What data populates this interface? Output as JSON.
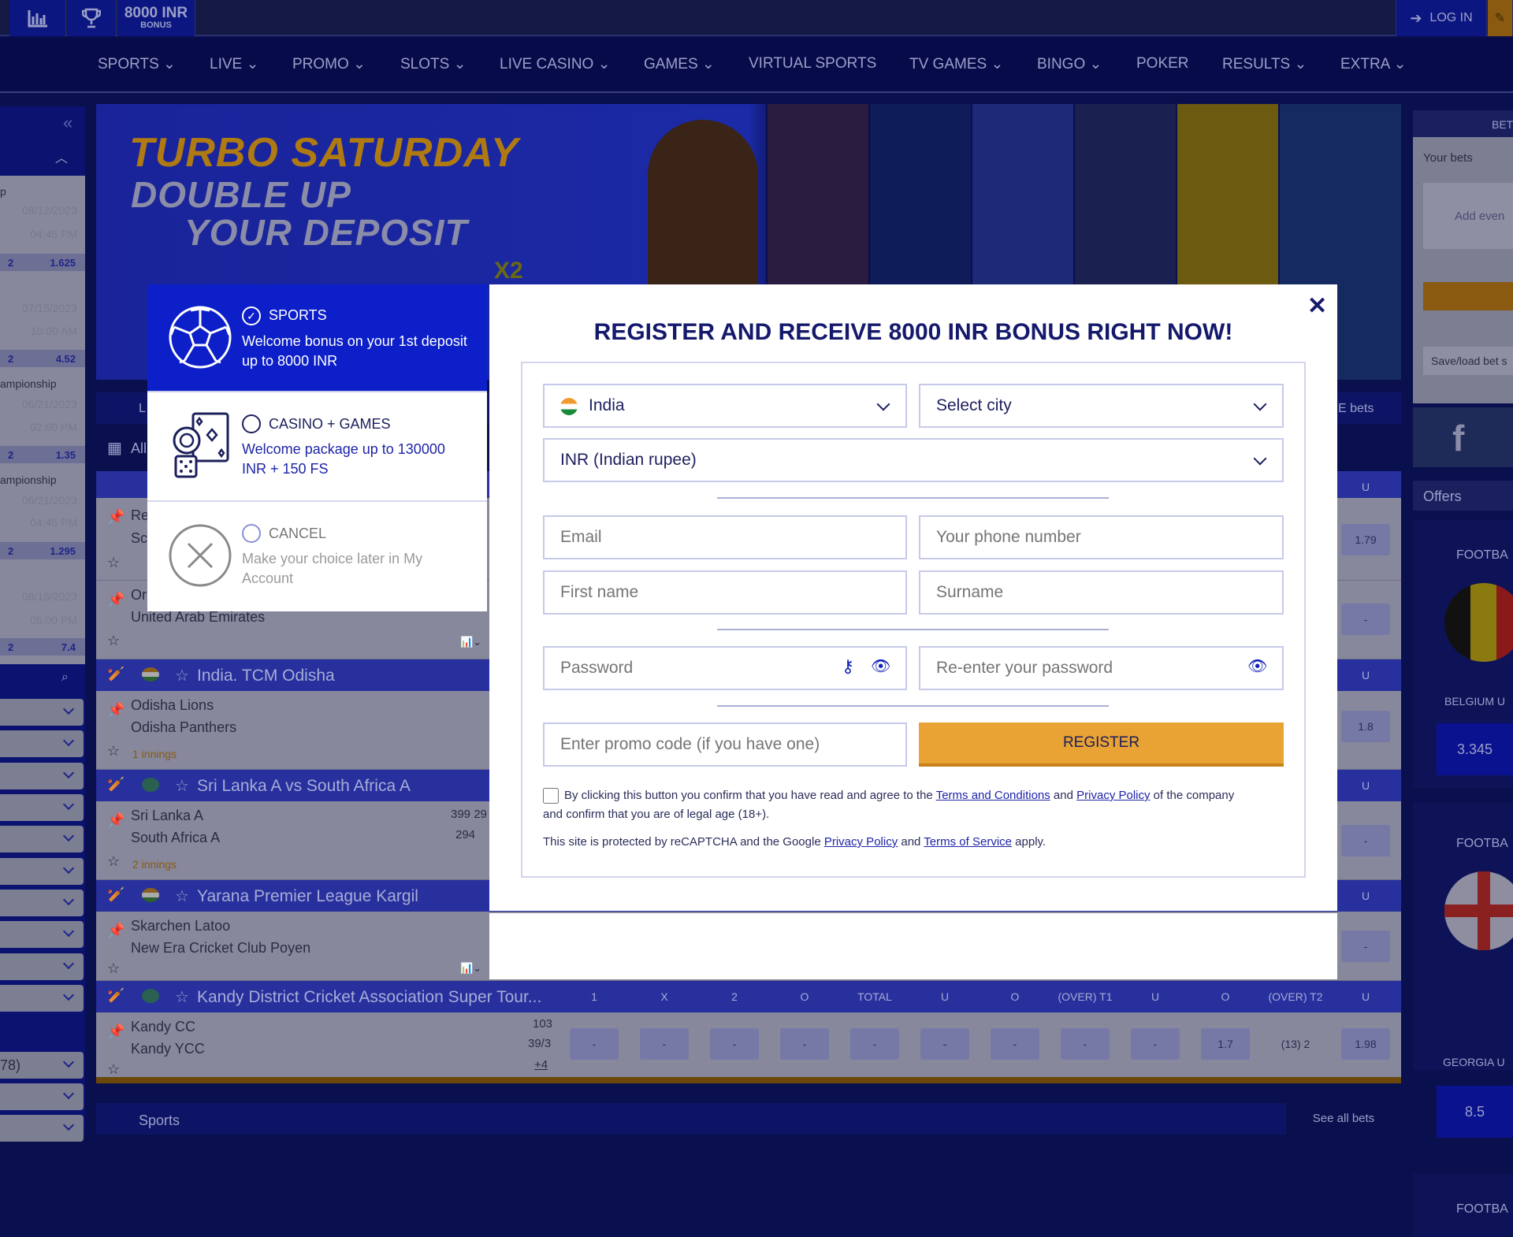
{
  "topbar": {
    "bonus_amount": "8000 INR",
    "bonus_label": "BONUS",
    "login_label": "LOG IN",
    "icons": [
      "stats-icon",
      "trophy-icon",
      "login-icon",
      "register-icon"
    ]
  },
  "nav": {
    "items": [
      {
        "label": "SPORTS",
        "dropdown": true
      },
      {
        "label": "LIVE",
        "dropdown": true
      },
      {
        "label": "PROMO",
        "dropdown": true
      },
      {
        "label": "SLOTS",
        "dropdown": true
      },
      {
        "label": "LIVE CASINO",
        "dropdown": true
      },
      {
        "label": "GAMES",
        "dropdown": true
      },
      {
        "label": "VIRTUAL SPORTS",
        "dropdown": false
      },
      {
        "label": "TV GAMES",
        "dropdown": true
      },
      {
        "label": "BINGO",
        "dropdown": true
      },
      {
        "label": "POKER",
        "dropdown": false
      },
      {
        "label": "RESULTS",
        "dropdown": true
      },
      {
        "label": "EXTRA",
        "dropdown": true
      }
    ]
  },
  "left_sidebar": {
    "events": [
      {
        "name": "p",
        "date": "08/12/2023",
        "time": "04:45 PM",
        "col": "2",
        "odds": "1.625"
      },
      {
        "name": "",
        "date": "07/15/2023",
        "time": "10:00 AM",
        "col": "2",
        "odds": "4.52"
      },
      {
        "name": "ampionship",
        "date": "06/21/2023",
        "time": "02:00 PM",
        "col": "2",
        "odds": "1.35"
      },
      {
        "name": "ampionship",
        "date": "06/21/2023",
        "time": "04:45 PM",
        "col": "2",
        "odds": "1.295"
      },
      {
        "name": "",
        "date": "08/16/2023",
        "time": "05:00 PM",
        "col": "2",
        "odds": "7.4"
      }
    ],
    "bottom_item": "78)"
  },
  "banner": {
    "line1": "TURBO SATURDAY",
    "line2": "DOUBLE UP",
    "line3": "YOUR DEPOSIT",
    "badge": "X2"
  },
  "events": {
    "live_tab": "L",
    "live_bets_tab": "E bets",
    "all_label": "All",
    "column_headers": [
      "1",
      "X",
      "2",
      "O",
      "TOTAL",
      "U",
      "O",
      "(OVER) T1",
      "U",
      "O",
      "(OVER) T2",
      "U"
    ],
    "groups": [
      {
        "title": "",
        "rows": [
          {
            "team1": "Re",
            "team2": "Sc",
            "last_odds": "1.79"
          },
          {
            "team1": "Or",
            "team2": "United Arab Emirates",
            "last_odds": "-"
          }
        ]
      },
      {
        "title": "India. TCM Odisha",
        "rows": [
          {
            "team1": "Odisha Lions",
            "team2": "Odisha Panthers",
            "note": "1 innings",
            "last_odds": "1.8"
          }
        ]
      },
      {
        "title": "Sri Lanka A vs South Africa A",
        "rows": [
          {
            "team1": "Sri Lanka A",
            "team2": "South Africa A",
            "note": "2 innings",
            "score1": "399 29",
            "score2": "294",
            "last_odds": "-"
          }
        ]
      },
      {
        "title": "Yarana Premier League Kargil",
        "rows": [
          {
            "team1": "Skarchen Latoo",
            "team2": "New Era Cricket Club Poyen",
            "last_odds": "-"
          }
        ]
      },
      {
        "title": "Kandy District Cricket Association Super Tour...",
        "rows": [
          {
            "team1": "Kandy CC",
            "team2": "Kandy YCC",
            "score1": "103",
            "score2": "39/3",
            "more": "+4",
            "odds": [
              "-",
              "-",
              "-",
              "-",
              "-",
              "-",
              "-",
              "-",
              "-",
              "1.7",
              "(13) 2",
              "1.98"
            ]
          }
        ]
      }
    ],
    "footer_label": "Sports",
    "see_all": "See all bets"
  },
  "right_sidebar": {
    "header": "BET",
    "your_bets": "Your bets",
    "add_events": "Add even",
    "save_load": "Save/load bet s",
    "offers": "Offers",
    "offers_list": [
      {
        "sport": "FOOTBA",
        "team": "BELGIUM U",
        "odds": "3.345"
      },
      {
        "sport": "FOOTBA",
        "team": "GEORGIA U",
        "odds": "8.5"
      },
      {
        "sport": "FOOTBA"
      }
    ]
  },
  "bonus_choice": {
    "options": [
      {
        "title": "SPORTS",
        "desc": "Welcome bonus on your 1st deposit up to 8000 INR",
        "selected": true,
        "icon": "soccer-ball-icon"
      },
      {
        "title": "CASINO + GAMES",
        "desc": "Welcome package up to 130000 INR + 150 FS",
        "selected": false,
        "icon": "casino-chips-cards-icon"
      },
      {
        "title": "CANCEL",
        "desc": "Make your choice later in My Account",
        "selected": false,
        "icon": "cancel-circle-icon"
      }
    ]
  },
  "register": {
    "title": "REGISTER AND RECEIVE 8000 INR BONUS RIGHT NOW!",
    "country": "India",
    "city_placeholder": "Select city",
    "currency": "INR (Indian rupee)",
    "email_placeholder": "Email",
    "phone_placeholder": "Your phone number",
    "first_name_placeholder": "First name",
    "surname_placeholder": "Surname",
    "password_placeholder": "Password",
    "repassword_placeholder": "Re-enter your password",
    "promo_placeholder": "Enter promo code (if you have one)",
    "register_button": "REGISTER",
    "consent_pre": "By clicking this button you confirm that you have read and agree to the ",
    "terms_link": "Terms and Conditions",
    "consent_and": " and ",
    "privacy_link": "Privacy Policy",
    "consent_post": " of the company",
    "consent_line2": "and confirm that you are of legal age (18+).",
    "recaptcha_pre": "This site is protected by reCAPTCHA and the Google ",
    "recaptcha_privacy": "Privacy Policy",
    "recaptcha_and": " and ",
    "recaptcha_terms": "Terms of Service",
    "recaptcha_post": " apply.",
    "consent_checked": false,
    "colors": {
      "accent": "#e9a234",
      "brand_blue": "#0c1fc8",
      "text": "#1c1f5e"
    }
  }
}
